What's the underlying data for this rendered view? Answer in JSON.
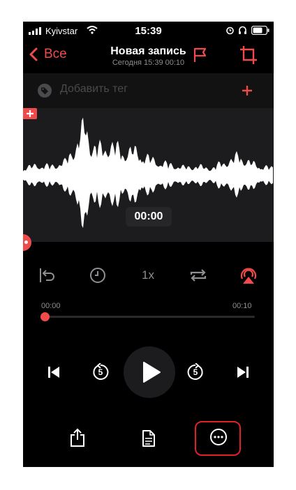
{
  "status_bar": {
    "carrier": "Kyivstar",
    "time": "15:39"
  },
  "nav": {
    "back_label": "Все",
    "title": "Новая запись",
    "subtitle": "Сегодня 15:39 00:10"
  },
  "tag_bar": {
    "placeholder": "Добавить тег"
  },
  "waveform": {
    "current_time": "00:00"
  },
  "playback": {
    "speed_label": "1x",
    "skip_back_seconds": "5",
    "skip_forward_seconds": "5",
    "progress_fraction": 0
  },
  "timeline": {
    "start": "00:00",
    "end": "00:10"
  },
  "colors": {
    "accent": "#f04b4b",
    "background": "#000000",
    "highlight_box": "#e0202a"
  }
}
